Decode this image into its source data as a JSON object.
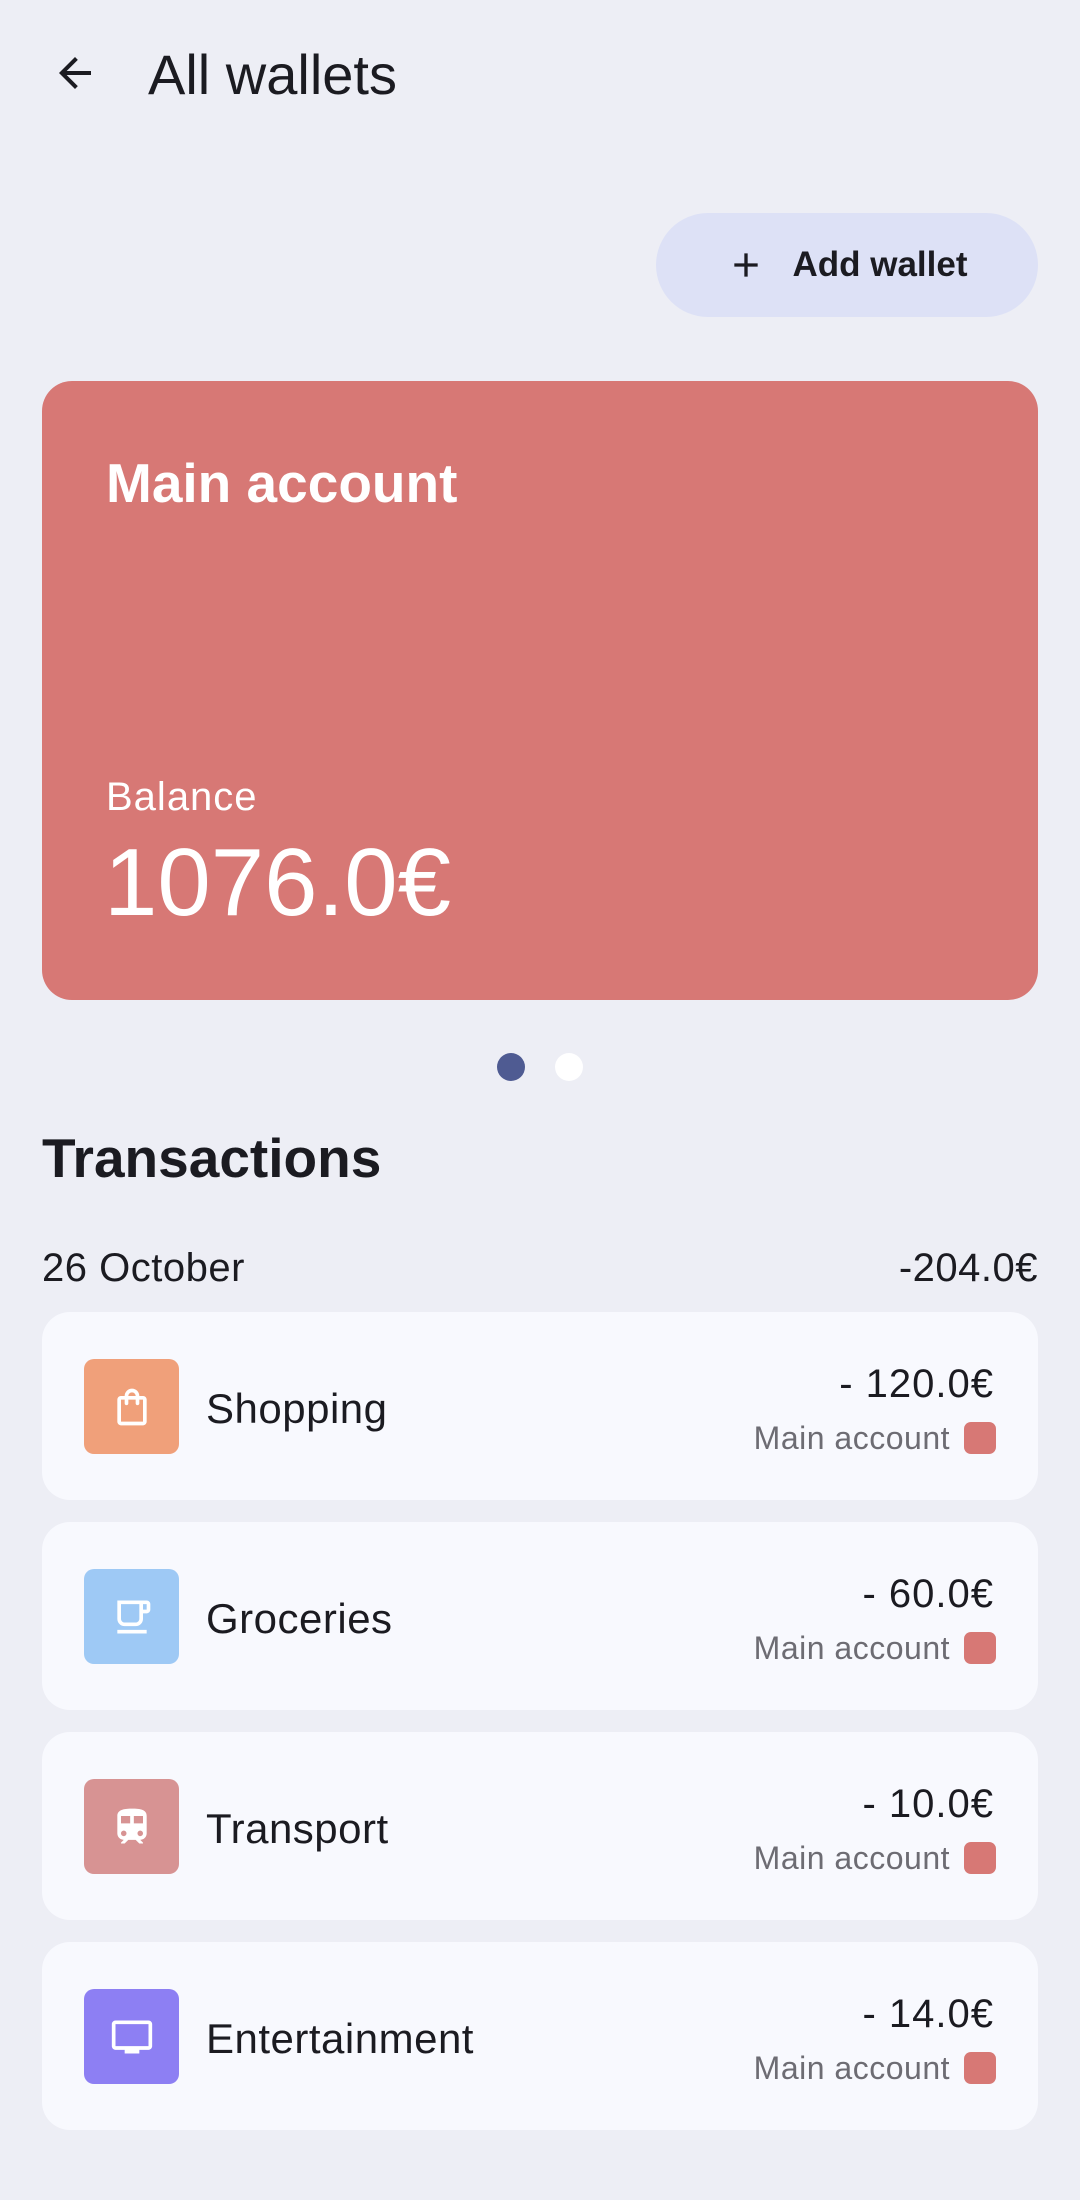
{
  "header": {
    "title": "All wallets",
    "back_icon": "arrow-back-icon"
  },
  "actions": {
    "add_wallet_label": "Add wallet",
    "add_wallet_icon": "plus-icon"
  },
  "wallet": {
    "name": "Main account",
    "balance_label": "Balance",
    "balance_value": "1076.0€",
    "color": "#d77875"
  },
  "pager": {
    "total_pages": 2,
    "active_page": 1
  },
  "transactions": {
    "title": "Transactions",
    "groups": [
      {
        "date": "26 October",
        "total": "-204.0€",
        "items": [
          {
            "category": "Shopping",
            "amount": "- 120.0€",
            "account": "Main account",
            "icon": "shopping-bag-icon",
            "icon_color": "#f0a07a",
            "account_color": "#d77875"
          },
          {
            "category": "Groceries",
            "amount": "- 60.0€",
            "account": "Main account",
            "icon": "cup-icon",
            "icon_color": "#9ec9f5",
            "account_color": "#d77875"
          },
          {
            "category": "Transport",
            "amount": "- 10.0€",
            "account": "Main account",
            "icon": "train-icon",
            "icon_color": "#d79393",
            "account_color": "#d77875"
          },
          {
            "category": "Entertainment",
            "amount": "- 14.0€",
            "account": "Main account",
            "icon": "tv-icon",
            "icon_color": "#8d7ff3",
            "account_color": "#d77875"
          }
        ]
      }
    ]
  }
}
